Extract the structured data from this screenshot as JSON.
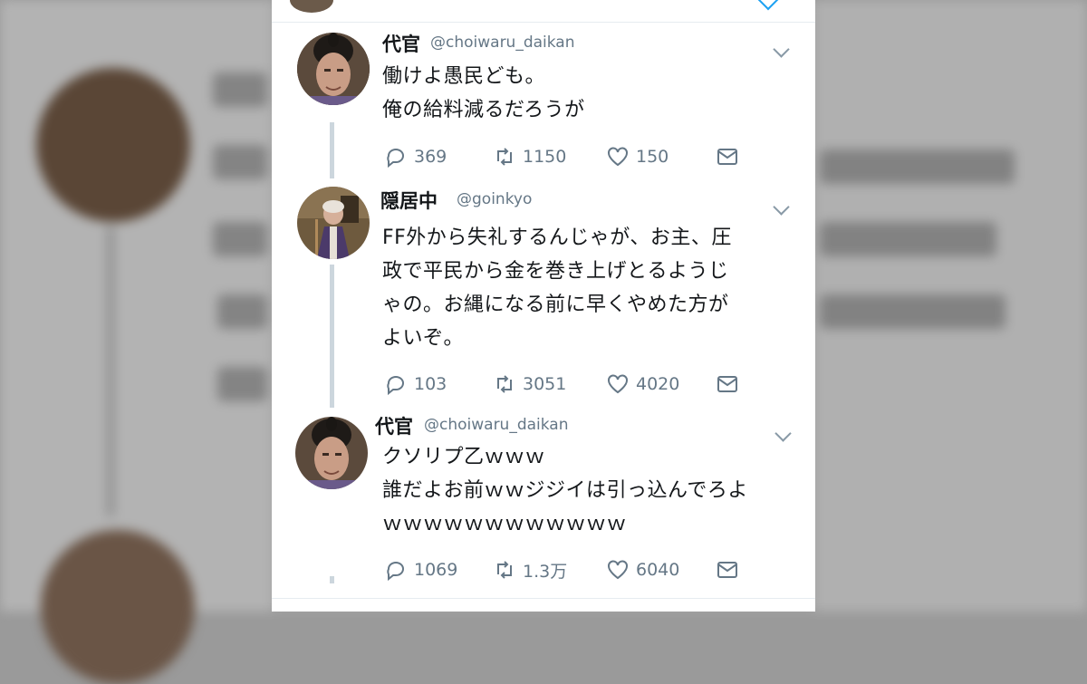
{
  "tweets": [
    {
      "name": "代官",
      "handle": "@choiwaru_daikan",
      "lines": [
        "働けよ愚民ども。",
        "俺の給料減るだろうが"
      ],
      "replies": "369",
      "retweets": "1150",
      "likes": "150"
    },
    {
      "name": "隠居中",
      "handle": "@goinkyo",
      "lines": [
        "FF外から失礼するんじゃが、お主、圧",
        "政で平民から金を巻き上げとるようじ",
        "ゃの。お縄になる前に早くやめた方が",
        "よいぞ。"
      ],
      "replies": "103",
      "retweets": "3051",
      "likes": "4020"
    },
    {
      "name": "代官",
      "handle": "@choiwaru_daikan",
      "lines": [
        "クソリプ乙ｗｗｗ",
        "誰だよお前ｗｗジジイは引っ込んでろよ",
        "ｗｗｗｗｗｗｗｗｗｗｗｗ"
      ],
      "replies": "1069",
      "retweets": "1.3万",
      "likes": "6040"
    }
  ],
  "icons": {
    "reply": "reply-icon",
    "retweet": "retweet-icon",
    "like": "heart-icon",
    "dm": "mail-icon",
    "menu": "chevron-down-icon"
  },
  "colors": {
    "icon_gray": "#657786",
    "text": "#14171a",
    "thread_line": "#ccd6dd",
    "link_blue": "#1da1f2"
  }
}
